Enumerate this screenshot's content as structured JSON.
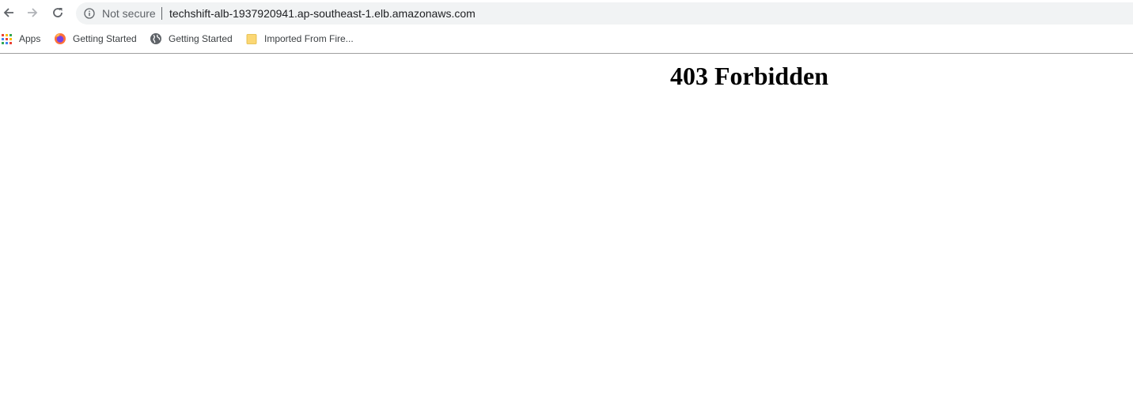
{
  "browser": {
    "toolbar": {
      "back_icon": "arrow-left-icon",
      "forward_icon": "arrow-right-icon",
      "reload_icon": "reload-icon"
    },
    "omnibox": {
      "security_icon": "info-icon",
      "security_label": "Not secure",
      "url": "techshift-alb-1937920941.ap-southeast-1.elb.amazonaws.com"
    },
    "bookmarks": [
      {
        "label": "Apps",
        "icon": "apps-grid-icon"
      },
      {
        "label": "Getting Started",
        "icon": "firefox-icon"
      },
      {
        "label": "Getting Started",
        "icon": "globe-icon"
      },
      {
        "label": "Imported From Fire...",
        "icon": "folder-icon"
      }
    ]
  },
  "page": {
    "heading": "403 Forbidden"
  },
  "colors": {
    "omnibox_bg": "#f1f3f4",
    "muted_text": "#5f6368",
    "folder": "#fbd774"
  }
}
